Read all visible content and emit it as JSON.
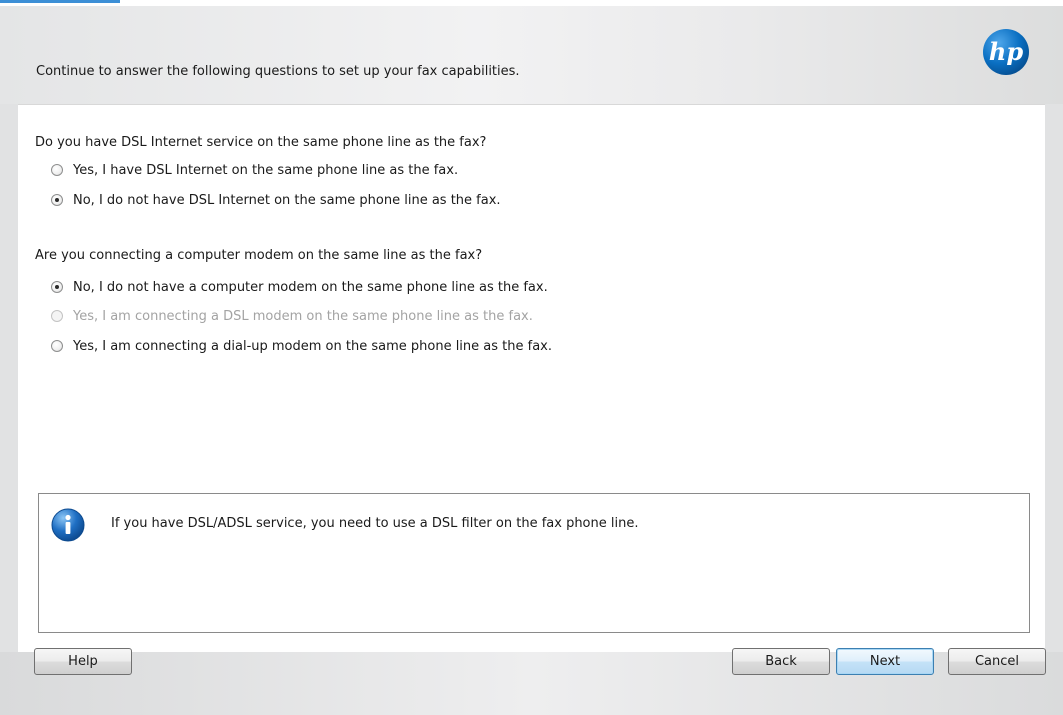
{
  "header": {
    "text": "Continue to answer the following questions to set up your fax capabilities."
  },
  "logo": {
    "text": "hp"
  },
  "question1": {
    "label": "Do you have DSL Internet service on the same phone line as the fax?",
    "options": [
      {
        "label": "Yes, I have DSL Internet on the same phone line as the fax.",
        "checked": false,
        "enabled": true
      },
      {
        "label": "No, I do not have DSL Internet on the same phone line as the fax.",
        "checked": true,
        "enabled": true
      }
    ]
  },
  "question2": {
    "label": "Are you connecting a computer modem on the same line as the fax?",
    "options": [
      {
        "label": "No, I do not have a computer modem on the same phone line as the fax.",
        "checked": true,
        "enabled": true
      },
      {
        "label": "Yes, I am connecting a DSL modem on the same phone line as the fax.",
        "checked": false,
        "enabled": false
      },
      {
        "label": "Yes, I am connecting a dial-up modem on the same phone line as the fax.",
        "checked": false,
        "enabled": true
      }
    ]
  },
  "info": {
    "icon": "info-icon",
    "text": "If you have DSL/ADSL service, you need to use a DSL filter on the fax phone line."
  },
  "buttons": {
    "help": "Help",
    "back": "Back",
    "next": "Next",
    "cancel": "Cancel"
  },
  "colors": {
    "accent": "#3c8fd6",
    "logo_blue": "#0a6fc2",
    "info_blue": "#1f6fc4"
  }
}
